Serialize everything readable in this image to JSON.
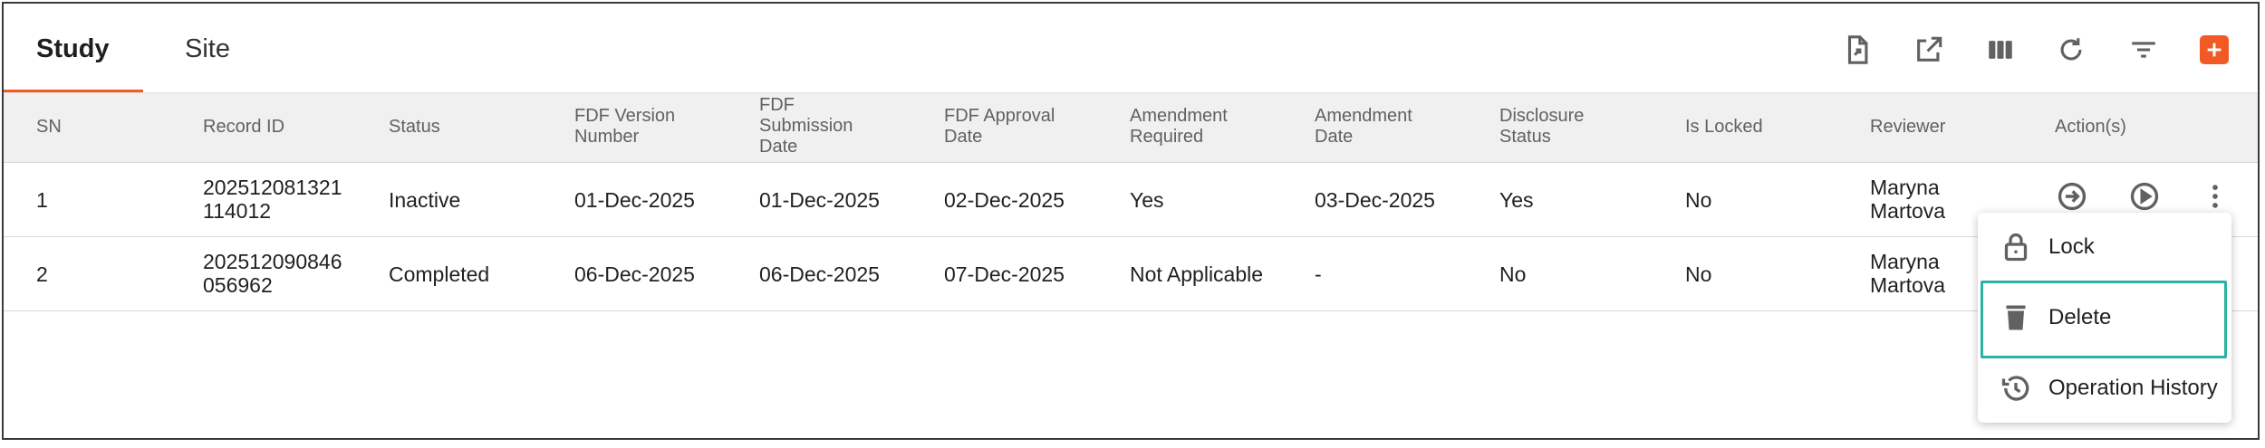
{
  "tabs": [
    {
      "label": "Study",
      "active": true
    },
    {
      "label": "Site",
      "active": false
    }
  ],
  "accent_color": "#f15a24",
  "highlight_color": "#2bb3a0",
  "toolbar": {
    "icons": [
      "export-file-icon",
      "open-external-icon",
      "columns-icon",
      "refresh-icon",
      "filter-icon",
      "add-icon"
    ]
  },
  "table": {
    "headers": {
      "sn": "SN",
      "record_id": "Record ID",
      "status": "Status",
      "fdf_version": [
        "FDF Version",
        "Number"
      ],
      "fdf_submission": [
        "FDF",
        "Submission",
        "Date"
      ],
      "fdf_approval": [
        "FDF Approval",
        "Date"
      ],
      "amendment_required": [
        "Amendment",
        "Required"
      ],
      "amendment_date": [
        "Amendment",
        "Date"
      ],
      "disclosure_status": [
        "Disclosure",
        "Status"
      ],
      "is_locked": "Is Locked",
      "reviewer": "Reviewer",
      "actions": "Action(s)"
    },
    "rows": [
      {
        "sn": "1",
        "record_id": [
          "202512081321",
          "114012"
        ],
        "status": "Inactive",
        "fdf_version": "01-Dec-2025",
        "fdf_submission": "01-Dec-2025",
        "fdf_approval": "02-Dec-2025",
        "amendment_required": "Yes",
        "amendment_date": "03-Dec-2025",
        "disclosure_status": "Yes",
        "is_locked": "No",
        "reviewer": [
          "Maryna",
          "Martova"
        ]
      },
      {
        "sn": "2",
        "record_id": [
          "202512090846",
          "056962"
        ],
        "status": "Completed",
        "fdf_version": "06-Dec-2025",
        "fdf_submission": "06-Dec-2025",
        "fdf_approval": "07-Dec-2025",
        "amendment_required": "Not Applicable",
        "amendment_date": "-",
        "disclosure_status": "No",
        "is_locked": "No",
        "reviewer": [
          "Maryna",
          "Martova"
        ]
      }
    ]
  },
  "menu": {
    "items": [
      {
        "label": "Lock",
        "icon": "lock-icon"
      },
      {
        "label": "Delete",
        "icon": "trash-icon",
        "highlighted": true
      },
      {
        "label": "Operation History",
        "icon": "history-icon"
      }
    ]
  }
}
